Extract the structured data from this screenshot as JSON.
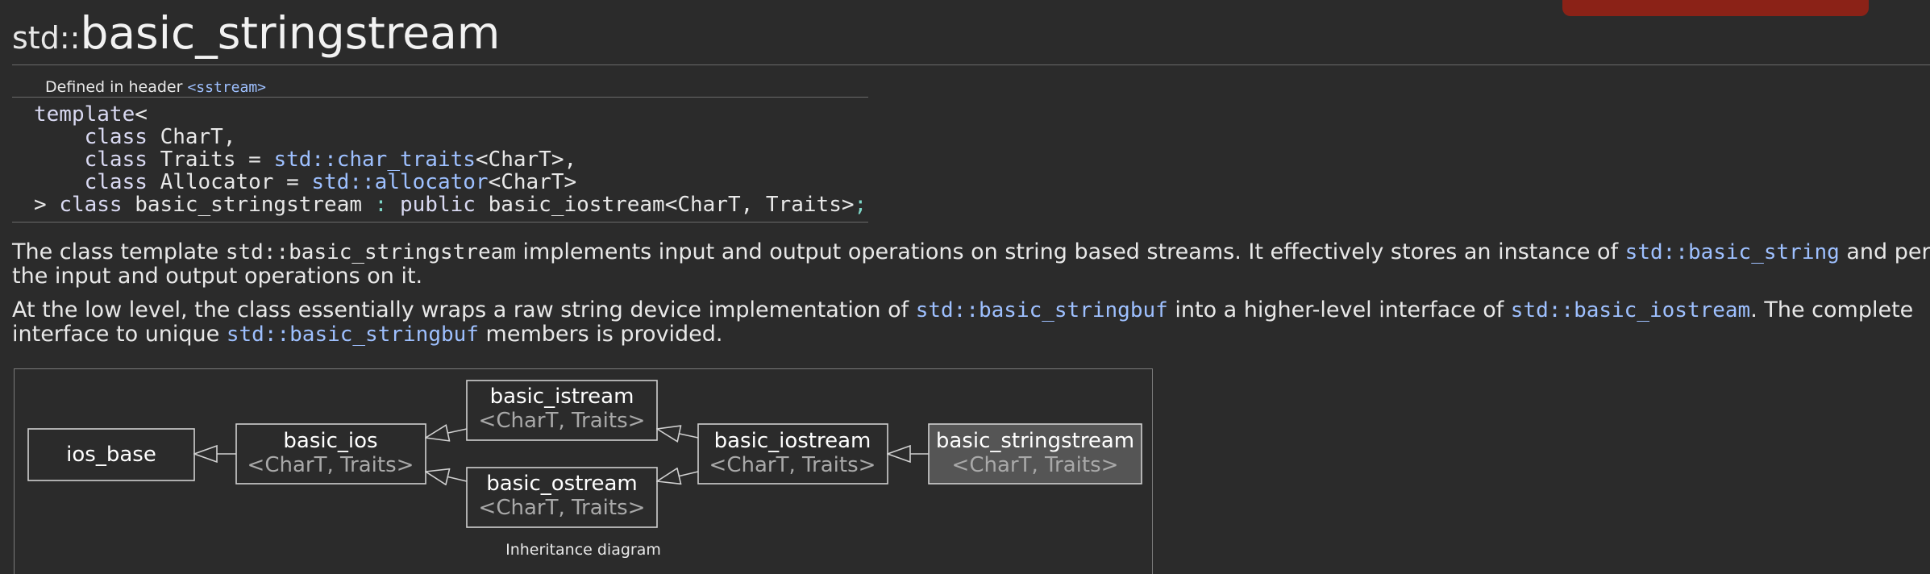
{
  "title": {
    "namespace": "std::",
    "name": "basic_stringstream"
  },
  "defined_in": {
    "label": "Defined in header",
    "header": "<sstream>"
  },
  "declaration": {
    "template_kw": "template",
    "lt": "<",
    "class_kw": "class",
    "line1_name": "CharT,",
    "line2_name": "Traits =",
    "line2_link": "std::char_traits",
    "line2_tail": "<CharT>,",
    "line3_name": "Allocator =",
    "line3_link": "std::allocator",
    "line3_tail": "<CharT>",
    "gt": ">",
    "line4_name": "basic_stringstream",
    "colon": ":",
    "public_kw": "public",
    "base": "basic_iostream<CharT, Traits>",
    "semicolon": ";"
  },
  "paragraphs": {
    "p1": {
      "a": "The class template ",
      "code": "std::basic_stringstream",
      "b": " implements input and output operations on string based streams. It effectively stores an instance of ",
      "link": "std::basic_string",
      "c": " and performs",
      "line2": "the input and output operations on it."
    },
    "p2": {
      "a": "At the low level, the class essentially wraps a raw string device implementation of ",
      "link1": "std::basic_stringbuf",
      "b": " into a higher-level interface of ",
      "link2": "std::basic_iostream",
      "c": ". The complete",
      "d": "interface to unique ",
      "link3": "std::basic_stringbuf",
      "e": " members is provided."
    }
  },
  "diagram": {
    "caption": "Inheritance diagram",
    "nodes": {
      "ios_base": {
        "title": "ios_base"
      },
      "basic_ios": {
        "title": "basic_ios",
        "sub": "<CharT, Traits>"
      },
      "basic_istream": {
        "title": "basic_istream",
        "sub": "<CharT, Traits>"
      },
      "basic_ostream": {
        "title": "basic_ostream",
        "sub": "<CharT, Traits>"
      },
      "basic_iostream": {
        "title": "basic_iostream",
        "sub": "<CharT, Traits>"
      },
      "basic_stringstream": {
        "title": "basic_stringstream",
        "sub": "<CharT, Traits>"
      }
    },
    "colors": {
      "highlight_fill": "#555555",
      "box_stroke": "#d0d0d0"
    }
  }
}
